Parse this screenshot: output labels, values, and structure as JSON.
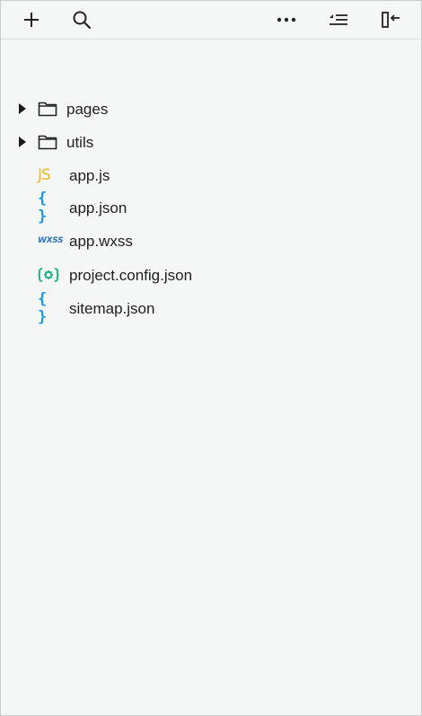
{
  "toolbar": {
    "add_icon": "plus-icon",
    "search_icon": "search-icon",
    "more_icon": "ellipsis-icon",
    "collapse_icon": "collapse-all-icon",
    "panel_icon": "toggle-panel-icon"
  },
  "tree": {
    "folders": [
      {
        "label": "pages",
        "icon": "folder-icon",
        "expanded": false
      },
      {
        "label": "utils",
        "icon": "folder-icon",
        "expanded": false
      }
    ],
    "files": [
      {
        "label": "app.js",
        "icon_text": "JS",
        "icon": "js-file-icon",
        "color": "#f0b429"
      },
      {
        "label": "app.json",
        "icon_text": "{ }",
        "icon": "json-file-icon",
        "color": "#1a9be0"
      },
      {
        "label": "app.wxss",
        "icon_text": "WXSS",
        "icon": "wxss-file-icon",
        "color": "#2a73b8"
      },
      {
        "label": "project.config.json",
        "icon": "config-file-icon",
        "color": "#16b07a"
      },
      {
        "label": "sitemap.json",
        "icon_text": "{ }",
        "icon": "json-file-icon",
        "color": "#1a9be0"
      }
    ]
  }
}
